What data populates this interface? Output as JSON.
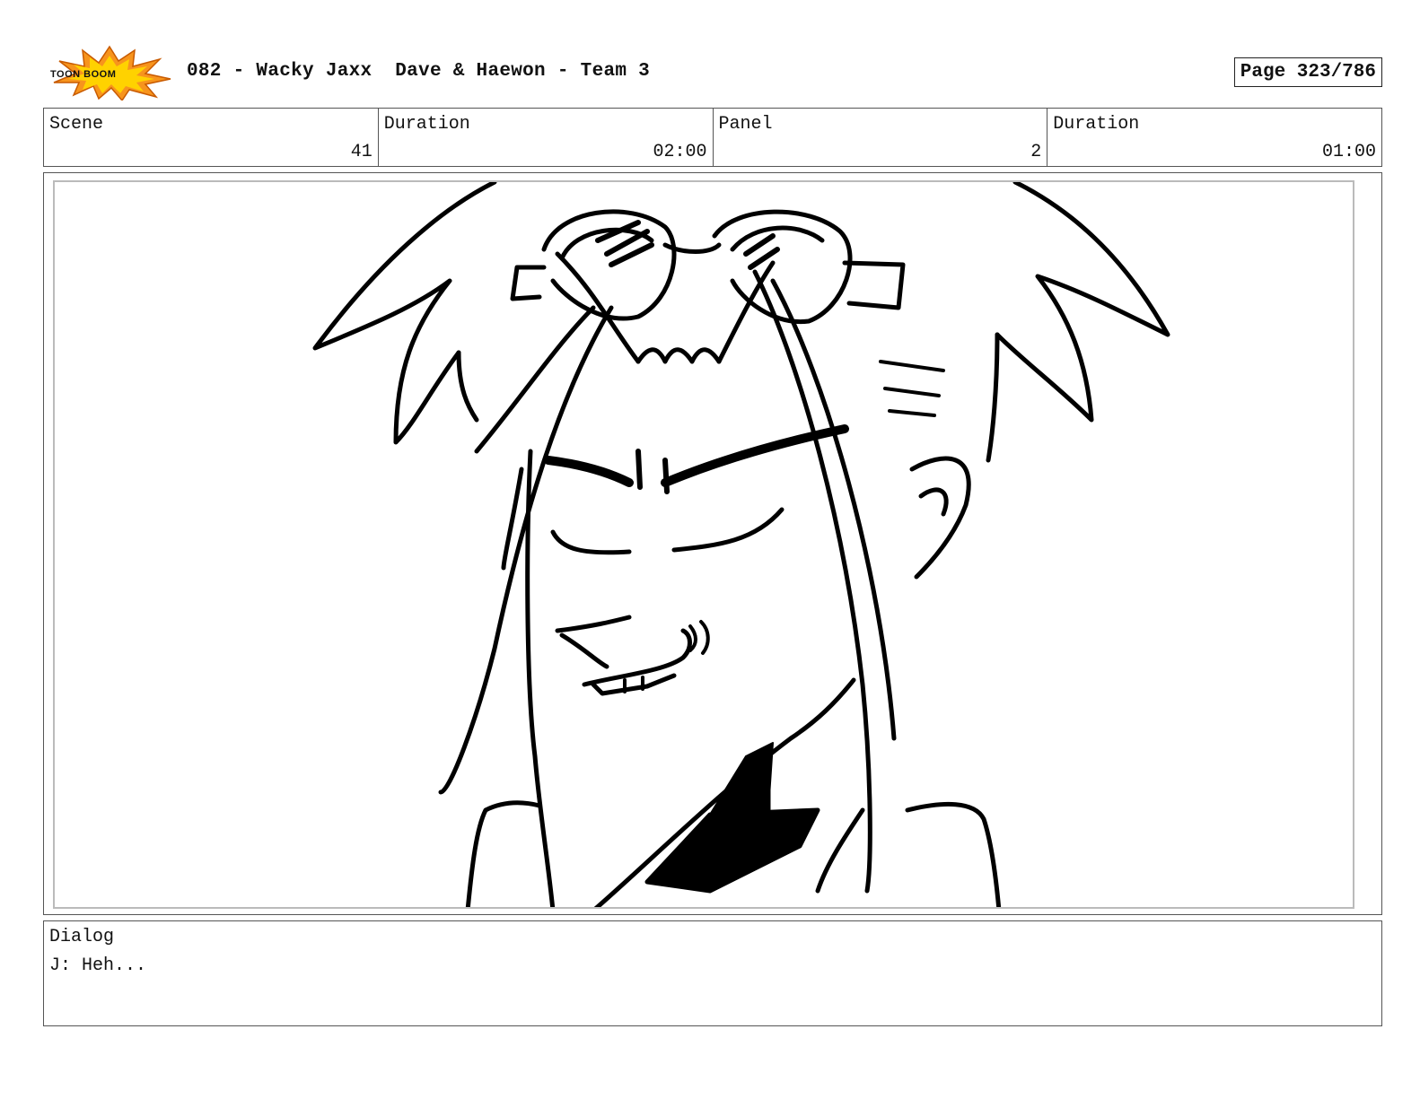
{
  "header": {
    "logo_text": "TOON BOOM",
    "title": "082 - Wacky Jaxx  Dave & Haewon - Team 3",
    "page_label": "Page 323/786"
  },
  "info": {
    "scene_label": "Scene",
    "scene_value": "41",
    "scene_duration_label": "Duration",
    "scene_duration_value": "02:00",
    "panel_label": "Panel",
    "panel_value": "2",
    "panel_duration_label": "Duration",
    "panel_duration_value": "01:00"
  },
  "panel": {
    "drawing": "sketch-character-icon"
  },
  "dialog": {
    "label": "Dialog",
    "text": "J: Heh..."
  },
  "colors": {
    "logo_orange": "#f7941d",
    "logo_yellow": "#ffd200",
    "ink": "#000000"
  }
}
